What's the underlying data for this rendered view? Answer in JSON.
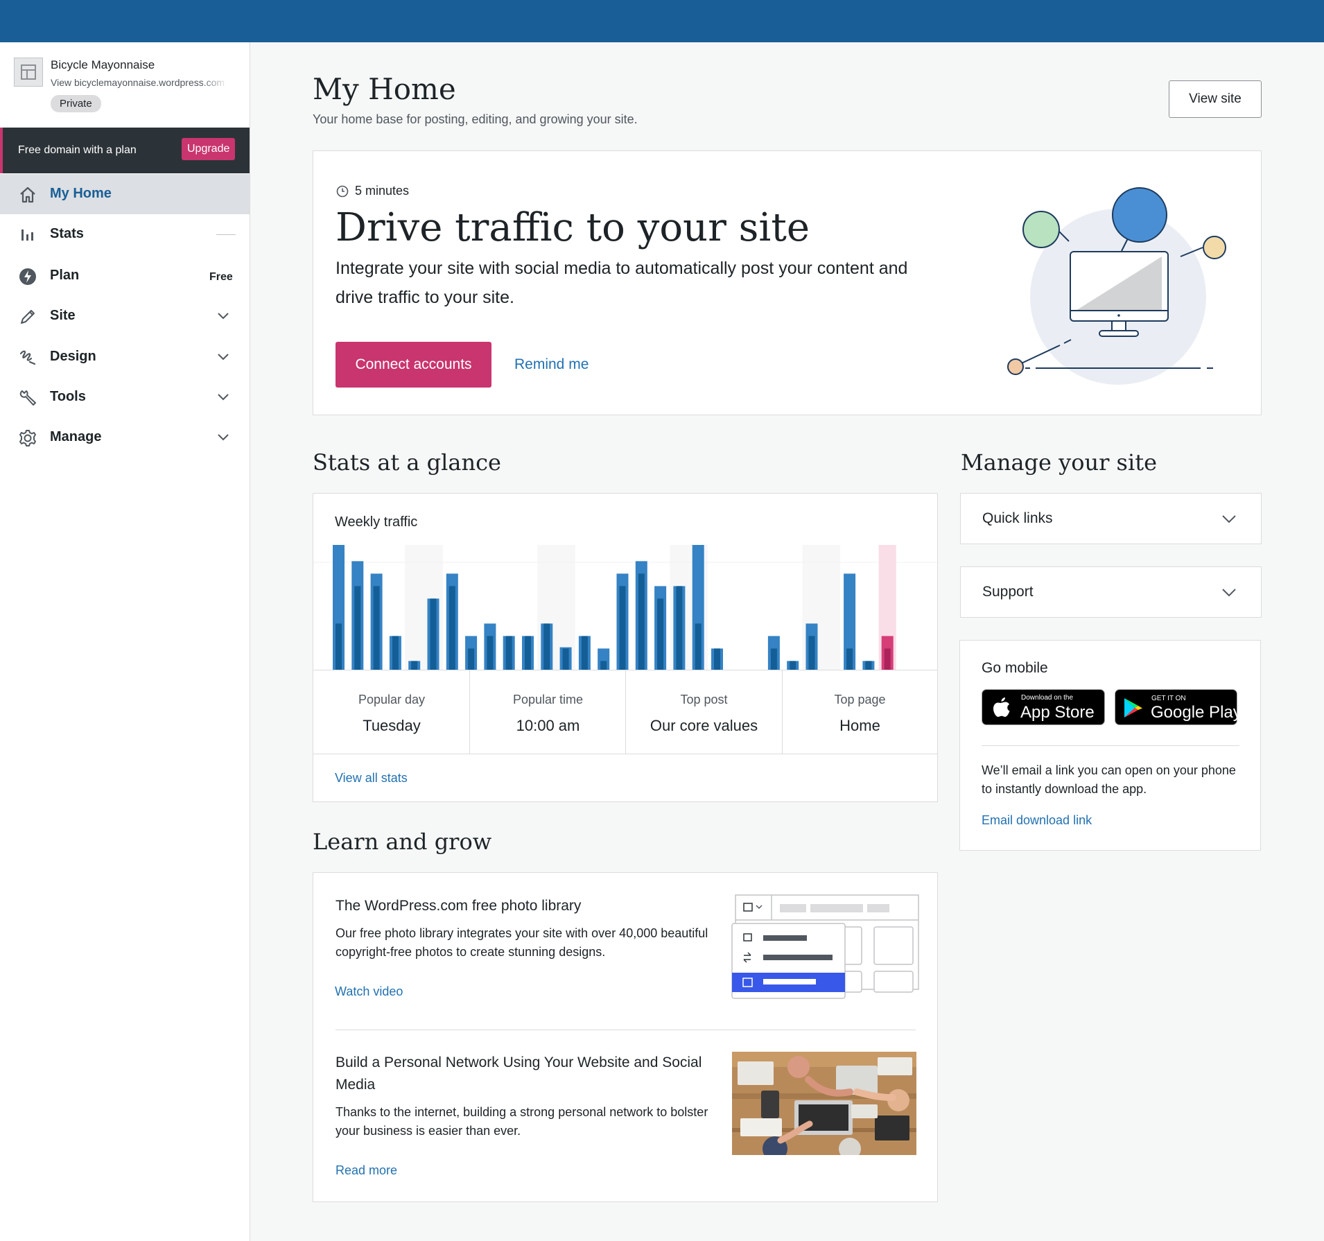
{
  "sidebar": {
    "site_name": "Bicycle Mayonnaise",
    "site_url": "View bicyclemayonnaise.wordpress.com",
    "site_status": "Private",
    "upsell_text": "Free domain with a plan",
    "upsell_button": "Upgrade",
    "items": [
      {
        "label": "My Home",
        "icon": "home-icon"
      },
      {
        "label": "Stats",
        "icon": "stats-icon"
      },
      {
        "label": "Plan",
        "icon": "plan-icon",
        "badge": "Free"
      },
      {
        "label": "Site",
        "icon": "pencil-icon"
      },
      {
        "label": "Design",
        "icon": "brush-icon"
      },
      {
        "label": "Tools",
        "icon": "wrench-icon"
      },
      {
        "label": "Manage",
        "icon": "gear-icon"
      }
    ]
  },
  "header": {
    "title": "My Home",
    "subtitle": "Your home base for posting, editing, and growing your site.",
    "view_site_button": "View site"
  },
  "task": {
    "time": "5 minutes",
    "title": "Drive traffic to your site",
    "description": "Integrate your site with social media to automatically post your content and drive traffic to your site.",
    "primary_button": "Connect accounts",
    "secondary_link": "Remind me"
  },
  "stats": {
    "heading": "Stats at a glance",
    "chart_title": "Weekly traffic",
    "cells": [
      {
        "label": "Popular day",
        "value": "Tuesday"
      },
      {
        "label": "Popular time",
        "value": "10:00 am"
      },
      {
        "label": "Top post",
        "value": "Our core values"
      },
      {
        "label": "Top page",
        "value": "Home"
      }
    ],
    "view_all_link": "View all stats"
  },
  "chart_data": {
    "type": "bar",
    "series": [
      {
        "values": [
          100,
          87,
          77,
          27,
          7,
          57,
          77,
          27,
          37,
          27,
          27,
          37,
          18,
          27,
          17,
          77,
          87,
          67,
          67,
          100,
          17,
          0,
          0,
          27,
          7,
          37,
          0,
          77,
          7,
          27
        ]
      },
      {
        "values": [
          37,
          67,
          67,
          27,
          7,
          57,
          67,
          17,
          27,
          27,
          27,
          37,
          17,
          27,
          7,
          67,
          77,
          57,
          67,
          37,
          17,
          0,
          0,
          17,
          7,
          27,
          0,
          17,
          7,
          17
        ]
      }
    ],
    "highlighted_index": 29,
    "colors": {
      "bar": "#3582c4",
      "bar_dark": "#135e96",
      "highlight": "#d63e78",
      "highlight_dark": "#ab235a"
    }
  },
  "manage": {
    "heading": "Manage your site",
    "quick_links": "Quick links",
    "support": "Support",
    "go_mobile": {
      "title": "Go mobile",
      "app_store_small": "Download on the",
      "app_store_big": "App Store",
      "google_small": "GET IT ON",
      "google_big": "Google Play",
      "description": "We’ll email a link you can open on your phone to instantly download the app.",
      "link": "Email download link"
    }
  },
  "learn": {
    "heading": "Learn and grow",
    "items": [
      {
        "title": "The WordPress.com free photo library",
        "description": "Our free photo library integrates your site with over 40,000 beautiful copyright-free photos to create stunning designs.",
        "link": "Watch video"
      },
      {
        "title": "Build a Personal Network Using Your Website and Social Media",
        "description": "Thanks to the internet, building a strong personal network to bolster your business is easier than ever.",
        "link": "Read more"
      }
    ]
  },
  "colors": {
    "topbar": "#195e96",
    "accent": "#c9356e",
    "link": "#2271b1"
  }
}
